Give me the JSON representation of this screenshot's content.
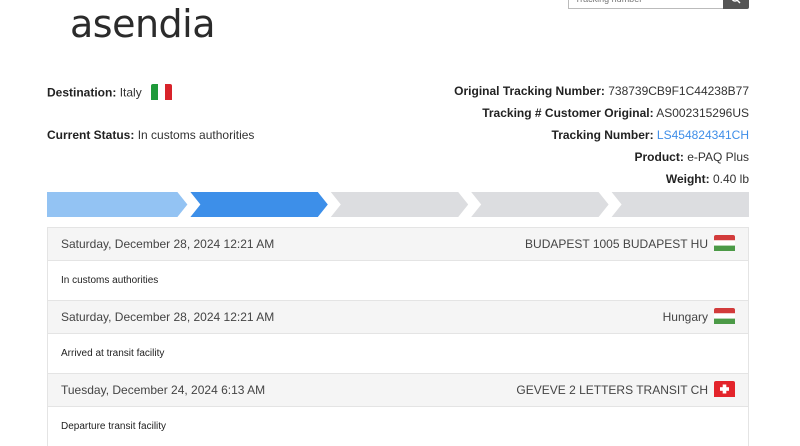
{
  "header": {
    "logo_text": "asendia",
    "search_placeholder": "Tracking number"
  },
  "shipment": {
    "destination_label": "Destination:",
    "destination_value": "Italy",
    "status_label": "Current Status:",
    "status_value": "In customs authorities",
    "original_tracking_label": "Original Tracking Number:",
    "original_tracking_value": "738739CB9F1C44238B77",
    "customer_original_label": "Tracking # Customer Original:",
    "customer_original_value": "AS002315296US",
    "tracking_label": "Tracking Number:",
    "tracking_value": "LS454824341CH",
    "product_label": "Product:",
    "product_value": "e-PAQ Plus",
    "weight_label": "Weight:",
    "weight_value": "0.40 lb"
  },
  "progress": {
    "total_steps": 5,
    "completed_steps": 2,
    "colors": {
      "done": "#93c3f3",
      "current": "#3d8fe9",
      "pending": "#dcdde0"
    }
  },
  "events": [
    {
      "datetime": "Saturday, December 28, 2024 12:21 AM",
      "location": "BUDAPEST 1005 BUDAPEST HU",
      "flag": "hungary-flag",
      "description": "In customs authorities"
    },
    {
      "datetime": "Saturday, December 28, 2024 12:21 AM",
      "location": "Hungary",
      "flag": "hungary-flag",
      "description": "Arrived at transit facility"
    },
    {
      "datetime": "Tuesday, December 24, 2024 6:13 AM",
      "location": "GEVEVE 2 LETTERS TRANSIT CH",
      "flag": "switzerland-flag",
      "description": "Departure transit facility"
    }
  ]
}
